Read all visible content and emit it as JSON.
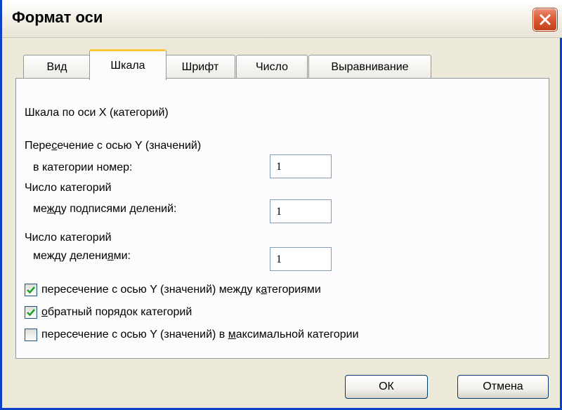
{
  "window": {
    "title": "Формат оси"
  },
  "tabs": [
    {
      "label": "Вид"
    },
    {
      "label": "Шкала"
    },
    {
      "label": "Шрифт"
    },
    {
      "label": "Число"
    },
    {
      "label": "Выравнивание"
    }
  ],
  "panel": {
    "heading": "Шкала по оси X (категорий)",
    "crossing_label_1_pre": "Пере",
    "crossing_label_1_u": "с",
    "crossing_label_1_post": "ечение с осью Y (значений)",
    "crossing_label_2": "в категории номер:",
    "crossing_value": "1",
    "labels_label_1": "Число категорий",
    "labels_label_2_pre": "ме",
    "labels_label_2_u": "ж",
    "labels_label_2_post": "ду подписями делений:",
    "labels_value": "1",
    "ticks_label_1": "Число категорий",
    "ticks_label_2_pre": "между делени",
    "ticks_label_2_u": "я",
    "ticks_label_2_post": "ми:",
    "ticks_value": "1"
  },
  "checkboxes": [
    {
      "pre": "пересечение с осью Y (значений) между к",
      "u": "а",
      "post": "тегориями",
      "checked": true
    },
    {
      "pre": "",
      "u": "о",
      "post": "братный порядок категорий",
      "checked": true
    },
    {
      "pre": "пересечение с осью Y (значений) в ",
      "u": "м",
      "post": "аксимальной категории",
      "checked": false
    }
  ],
  "buttons": {
    "ok": "ОК",
    "cancel": "Отмена"
  },
  "colors": {
    "accent": "#ffc83c",
    "check": "#21a121",
    "close": "#dc5b35",
    "frame": "#0b43c8"
  }
}
